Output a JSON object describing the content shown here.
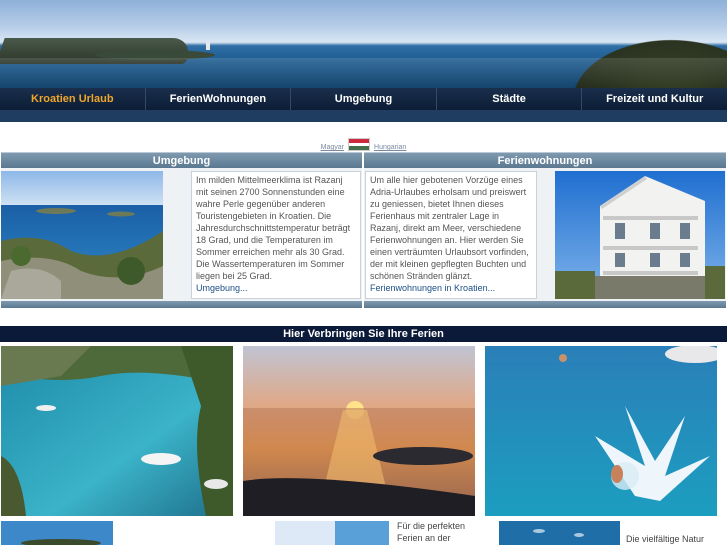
{
  "nav": {
    "items": [
      {
        "label": "Kroatien Urlaub",
        "active": true
      },
      {
        "label": "FerienWohnungen",
        "active": false
      },
      {
        "label": "Umgebung",
        "active": false
      },
      {
        "label": "Städte",
        "active": false
      },
      {
        "label": "Freizeit und Kultur",
        "active": false
      }
    ]
  },
  "language": {
    "magyar": "Magyar",
    "hungarian": "Hungarian",
    "flag_colors": [
      "#cd2a3e",
      "#ffffff",
      "#436f4d"
    ]
  },
  "umgebung": {
    "title": "Umgebung",
    "text": "Im milden Mittelmeerklima ist Razanj mit seinen 2700 Sonnenstunden eine wahre Perle gegenüber anderen Touristengebieten in Kroatien. Die Jahresdurchschnittstemperatur beträgt 18 Grad, und die Temperaturen im Sommer erreichen mehr als 30 Grad. Die Wassertemperaturen im Sommer liegen bei 25 Grad.",
    "link": "Umgebung..."
  },
  "ferienwohnungen": {
    "title": "Ferienwohnungen",
    "text": "Um alle hier gebotenen Vorzüge eines Adria-Urlaubes erholsam und preiswert zu geniessen, bietet Ihnen dieses Ferienhaus mit zentraler Lage in Razanj, direkt am Meer, verschiedene Ferienwohnungen an. Hier werden Sie einen verträumten Urlaubsort vorfinden, der mit kleinen gepflegten Buchten und schönen Stränden glänzt.",
    "link": "Ferienwohnungen in Kroatien..."
  },
  "ferien": {
    "title": "Hier Verbringen Sie Ihre Ferien"
  },
  "bottom": {
    "text1_line1": "Für die perfekten",
    "text1_line2": "Ferien an der",
    "text2_line1": "Die vielfältige Natur"
  },
  "colors": {
    "nav_bg": "#0c1d35",
    "nav_active": "#f0a52b",
    "section_head": "#6a8aa2",
    "ferien_bar": "#0c1a3a",
    "link": "#1c4f86"
  }
}
